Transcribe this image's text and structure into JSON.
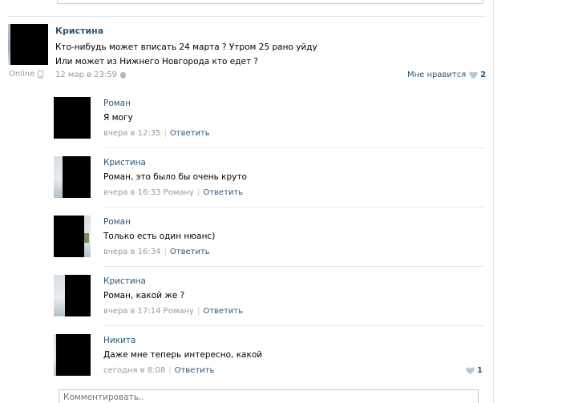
{
  "post": {
    "author": "Кристина",
    "line1": "Кто-нибудь может вписать 24 марта ? Утром 25 рано уйду",
    "line2": "Или может из Нижнего Новгорода кто едет ?",
    "date": "12 мар в 23:59",
    "like_label": "Мне нравится",
    "like_count": "2",
    "online_label": "Online"
  },
  "replies": [
    {
      "name": "Роман",
      "text": "Я могу",
      "time": "вчера в 12:35",
      "reply": "Ответить"
    },
    {
      "name": "Кристина",
      "text": "Роман, это было бы очень круто",
      "time": "вчера в 16:33 Роману",
      "reply": "Ответить"
    },
    {
      "name": "Роман",
      "text": "Только есть один нюанс)",
      "time": "вчера в 16:34",
      "reply": "Ответить"
    },
    {
      "name": "Кристина",
      "text": "Роман, какой же ?",
      "time": "вчера в 17:14 Роману",
      "reply": "Ответить"
    },
    {
      "name": "Никита",
      "text": "Даже мне теперь интересно, какой",
      "time": "сегодня в 8:08",
      "reply": "Ответить",
      "likes": "1"
    }
  ],
  "comment_input": {
    "placeholder": "Комментировать.."
  },
  "colors": {
    "link": "#2b587a",
    "meta": "#999999",
    "divider": "#e4e8ed",
    "heart": "#b7c7d6"
  },
  "icons": {
    "online": "mobile-phone-icon",
    "post_source": "apple-icon",
    "like": "heart-icon"
  }
}
